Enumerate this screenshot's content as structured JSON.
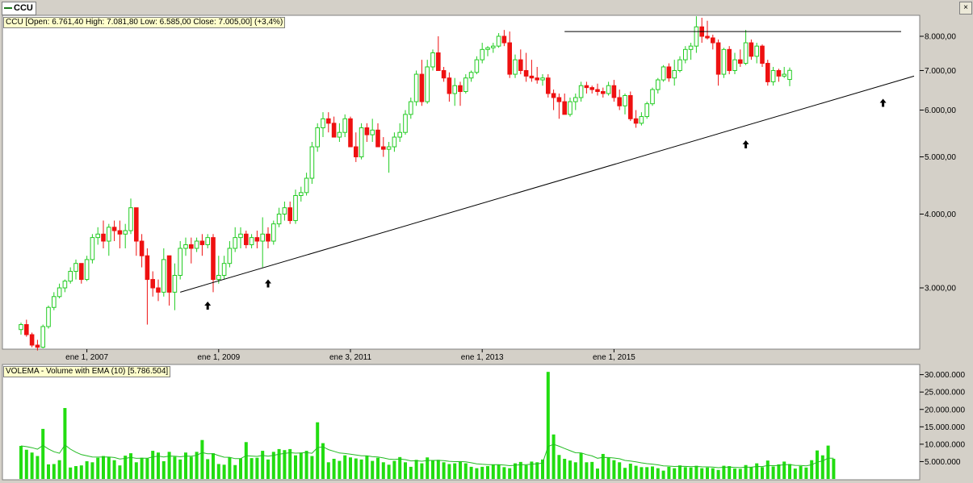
{
  "window": {
    "symbol_tab": "CCU",
    "close_glyph": "×"
  },
  "price_panel": {
    "info": "CCU [Open: 6.761,40  High: 7.081,80  Low: 6.585,00  Close: 7.005,00] (+3,4%)",
    "y_ticks": [
      "8.000,00",
      "7.000,00",
      "6.000,00",
      "5.000,00",
      "4.000,00",
      "3.000,00"
    ],
    "x_ticks": [
      "ene 1, 2007",
      "ene 1, 2009",
      "ene 3, 2011",
      "ene 1, 2013",
      "ene 1, 2015"
    ]
  },
  "volume_panel": {
    "info": "VOLEMA - Volume with EMA (10) [5.786.504]",
    "y_ticks": [
      "30.000.000",
      "25.000.000",
      "20.000.000",
      "15.000.000",
      "10.000.000",
      "5.000.000"
    ]
  },
  "colors": {
    "up": "#22cc22",
    "down": "#ee1111",
    "volume": "#22dd11",
    "ema": "#22bb22",
    "line": "#000000"
  },
  "chart_data": {
    "type": "candlestick",
    "frequency": "monthly",
    "price_scale": "log",
    "price_ylim": [
      2400,
      8600
    ],
    "volume_ylim": [
      0,
      32000000
    ],
    "annotations": [
      {
        "type": "resistance_line",
        "level": 8150
      },
      {
        "type": "support_trendline",
        "from": 2950,
        "to": 6850
      },
      {
        "type": "up_arrows",
        "count": 4
      }
    ],
    "candles": [
      [
        2550,
        2620,
        2500,
        2600
      ],
      [
        2600,
        2650,
        2480,
        2500
      ],
      [
        2500,
        2520,
        2380,
        2400
      ],
      [
        2400,
        2450,
        2350,
        2380
      ],
      [
        2380,
        2600,
        2370,
        2580
      ],
      [
        2580,
        2800,
        2560,
        2780
      ],
      [
        2780,
        2950,
        2750,
        2900
      ],
      [
        2900,
        3050,
        2880,
        3000
      ],
      [
        3000,
        3100,
        2950,
        3080
      ],
      [
        3080,
        3250,
        3050,
        3200
      ],
      [
        3200,
        3350,
        3100,
        3300
      ],
      [
        3300,
        3300,
        3050,
        3100
      ],
      [
        3100,
        3400,
        3080,
        3350
      ],
      [
        3350,
        3700,
        3300,
        3650
      ],
      [
        3650,
        3800,
        3550,
        3700
      ],
      [
        3700,
        3900,
        3500,
        3600
      ],
      [
        3600,
        3850,
        3400,
        3800
      ],
      [
        3800,
        3900,
        3600,
        3750
      ],
      [
        3750,
        3900,
        3500,
        3700
      ],
      [
        3700,
        3850,
        3500,
        3750
      ],
      [
        3750,
        4250,
        3700,
        4100
      ],
      [
        4100,
        4100,
        3400,
        3600
      ],
      [
        3600,
        3700,
        3250,
        3400
      ],
      [
        3400,
        3500,
        2600,
        3100
      ],
      [
        3100,
        3200,
        2900,
        3000
      ],
      [
        3000,
        3100,
        2850,
        2950
      ],
      [
        2950,
        3500,
        2900,
        3350
      ],
      [
        3400,
        3400,
        2800,
        2950
      ],
      [
        2950,
        3300,
        2750,
        3150
      ],
      [
        3150,
        3600,
        3100,
        3500
      ],
      [
        3500,
        3650,
        3400,
        3550
      ],
      [
        3550,
        3650,
        3300,
        3500
      ],
      [
        3500,
        3650,
        3450,
        3600
      ],
      [
        3600,
        3700,
        3400,
        3550
      ],
      [
        3550,
        3700,
        3500,
        3650
      ],
      [
        3650,
        3700,
        2950,
        3100
      ],
      [
        3100,
        3400,
        3050,
        3150
      ],
      [
        3150,
        3400,
        3100,
        3300
      ],
      [
        3300,
        3600,
        3250,
        3500
      ],
      [
        3500,
        3800,
        3450,
        3650
      ],
      [
        3650,
        3800,
        3500,
        3700
      ],
      [
        3700,
        3750,
        3500,
        3550
      ],
      [
        3550,
        3700,
        3500,
        3650
      ],
      [
        3650,
        3750,
        3500,
        3600
      ],
      [
        3600,
        3950,
        3250,
        3700
      ],
      [
        3700,
        3800,
        3500,
        3600
      ],
      [
        3600,
        3900,
        3550,
        3850
      ],
      [
        3850,
        4100,
        3800,
        4000
      ],
      [
        4000,
        4200,
        3900,
        4100
      ],
      [
        4100,
        4200,
        3850,
        3900
      ],
      [
        3900,
        4400,
        3850,
        4300
      ],
      [
        4300,
        4450,
        4200,
        4350
      ],
      [
        4350,
        4700,
        4300,
        4600
      ],
      [
        4600,
        5300,
        4500,
        5200
      ],
      [
        5200,
        5700,
        5100,
        5600
      ],
      [
        5600,
        5950,
        5400,
        5800
      ],
      [
        5800,
        5950,
        5500,
        5700
      ],
      [
        5700,
        5850,
        5400,
        5400
      ],
      [
        5400,
        5700,
        5300,
        5500
      ],
      [
        5500,
        5900,
        5400,
        5800
      ],
      [
        5800,
        5850,
        5200,
        5200
      ],
      [
        5200,
        5500,
        4900,
        5000
      ],
      [
        5000,
        5700,
        4950,
        5600
      ],
      [
        5600,
        5700,
        5300,
        5450
      ],
      [
        5450,
        5800,
        5300,
        5550
      ],
      [
        5550,
        5700,
        5200,
        5200
      ],
      [
        5200,
        5400,
        5000,
        5150
      ],
      [
        5150,
        5300,
        4700,
        5200
      ],
      [
        5200,
        5500,
        5100,
        5400
      ],
      [
        5400,
        5700,
        5300,
        5500
      ],
      [
        5500,
        6000,
        5450,
        5900
      ],
      [
        5900,
        6300,
        5800,
        6200
      ],
      [
        6200,
        7000,
        6100,
        6900
      ],
      [
        6900,
        7300,
        6100,
        6200
      ],
      [
        6200,
        7300,
        6150,
        7100
      ],
      [
        7100,
        7600,
        7000,
        7500
      ],
      [
        7500,
        8000,
        7000,
        7000
      ],
      [
        7000,
        7100,
        6700,
        6800
      ],
      [
        6800,
        6950,
        6200,
        6400
      ],
      [
        6400,
        6800,
        6100,
        6600
      ],
      [
        6600,
        6700,
        6100,
        6450
      ],
      [
        6450,
        6900,
        6400,
        6800
      ],
      [
        6800,
        7000,
        6700,
        6950
      ],
      [
        6950,
        7400,
        6900,
        7300
      ],
      [
        7300,
        7800,
        7200,
        7600
      ],
      [
        7600,
        7700,
        7400,
        7650
      ],
      [
        7650,
        7800,
        7500,
        7700
      ],
      [
        7700,
        8100,
        7650,
        8000
      ],
      [
        8000,
        8200,
        7700,
        7800
      ],
      [
        7800,
        8150,
        6800,
        6900
      ],
      [
        6900,
        7450,
        6800,
        7300
      ],
      [
        7300,
        7600,
        6900,
        7000
      ],
      [
        7000,
        7500,
        6700,
        6850
      ],
      [
        6850,
        7300,
        6700,
        6800
      ],
      [
        6800,
        7100,
        6650,
        6750
      ],
      [
        6750,
        6900,
        6600,
        6800
      ],
      [
        6800,
        6900,
        6300,
        6400
      ],
      [
        6400,
        6500,
        6000,
        6300
      ],
      [
        6300,
        6400,
        5800,
        6200
      ],
      [
        6200,
        6400,
        5900,
        5900
      ],
      [
        5900,
        6300,
        5850,
        6200
      ],
      [
        6200,
        6400,
        6000,
        6300
      ],
      [
        6300,
        6700,
        6200,
        6600
      ],
      [
        6600,
        6700,
        6400,
        6550
      ],
      [
        6550,
        6600,
        6400,
        6500
      ],
      [
        6500,
        6650,
        6350,
        6450
      ],
      [
        6450,
        6550,
        6300,
        6400
      ],
      [
        6400,
        6700,
        6350,
        6600
      ],
      [
        6600,
        6750,
        6200,
        6300
      ],
      [
        6300,
        6500,
        6000,
        6100
      ],
      [
        6100,
        6400,
        5900,
        6350
      ],
      [
        6350,
        6450,
        5750,
        5800
      ],
      [
        5800,
        6000,
        5600,
        5700
      ],
      [
        5700,
        5950,
        5650,
        5850
      ],
      [
        5850,
        6200,
        5800,
        6150
      ],
      [
        6150,
        6550,
        6100,
        6500
      ],
      [
        6500,
        6800,
        6400,
        6750
      ],
      [
        6750,
        7150,
        6700,
        7100
      ],
      [
        7100,
        7200,
        6700,
        6800
      ],
      [
        6800,
        7300,
        6600,
        7000
      ],
      [
        7000,
        7400,
        6950,
        7300
      ],
      [
        7300,
        7700,
        7200,
        7600
      ],
      [
        7600,
        7800,
        7300,
        7700
      ],
      [
        7700,
        8650,
        7500,
        8300
      ],
      [
        8300,
        8600,
        7800,
        8000
      ],
      [
        8000,
        8500,
        7900,
        7950
      ],
      [
        7950,
        8050,
        7600,
        7800
      ],
      [
        7800,
        7900,
        6600,
        6900
      ],
      [
        6900,
        7650,
        6800,
        7600
      ],
      [
        7600,
        7700,
        6900,
        7000
      ],
      [
        7000,
        7500,
        6900,
        7300
      ],
      [
        7300,
        7600,
        7100,
        7200
      ],
      [
        7200,
        8200,
        7150,
        7800
      ],
      [
        7800,
        7900,
        7300,
        7400
      ],
      [
        7400,
        7800,
        7200,
        7700
      ],
      [
        7700,
        7750,
        7100,
        7200
      ],
      [
        7200,
        7300,
        6600,
        6700
      ],
      [
        6700,
        7100,
        6600,
        7000
      ],
      [
        7000,
        7050,
        6700,
        6850
      ],
      [
        6850,
        7100,
        6800,
        6900
      ],
      [
        6761,
        7082,
        6585,
        7005
      ]
    ],
    "volume": [
      9.5,
      8.4,
      7.6,
      6.6,
      14.4,
      4.2,
      4.3,
      5.4,
      20.4,
      3.3,
      3.7,
      3.9,
      5.1,
      4.8,
      6.1,
      6.6,
      6.3,
      5.4,
      3.9,
      6.7,
      7.4,
      4.8,
      6.1,
      5.9,
      8.1,
      7.6,
      5.1,
      7.8,
      6.4,
      5.6,
      7.6,
      6.4,
      7.8,
      11.2,
      5.7,
      7.4,
      4.3,
      4.1,
      6.2,
      4.0,
      5.9,
      10.6,
      6.0,
      6.1,
      8.1,
      5.6,
      7.8,
      8.6,
      8.3,
      8.6,
      6.8,
      7.6,
      8.1,
      6.6,
      16.3,
      10.3,
      4.8,
      5.8,
      5.2,
      6.8,
      6.2,
      5.9,
      5.6,
      6.6,
      5.2,
      6.1,
      4.8,
      4.1,
      5.2,
      6.3,
      4.8,
      3.5,
      5.5,
      4.5,
      6.2,
      5.4,
      5.5,
      4.8,
      4.3,
      4.5,
      5.1,
      4.5,
      3.5,
      3.1,
      3.5,
      3.7,
      4.1,
      4.1,
      3.4,
      3.1,
      4.5,
      4.9,
      4.0,
      5.0,
      4.8,
      5.6,
      30.8,
      12.8,
      6.9,
      5.8,
      5.3,
      4.8,
      7.4,
      4.8,
      4.9,
      3.0,
      7.2,
      6.1,
      5.4,
      4.8,
      3.2,
      4.4,
      3.8,
      3.4,
      3.4,
      3.6,
      3.1,
      2.4,
      3.5,
      3.1,
      3.9,
      3.4,
      3.3,
      3.8,
      3.1,
      3.3,
      3.1,
      2.6,
      3.8,
      3.7,
      3.0,
      2.9,
      4.0,
      3.4,
      4.5,
      3.4,
      5.3,
      3.6,
      4.2,
      5.0,
      4.3,
      3.0,
      3.7,
      3.3,
      5.4,
      8.2,
      6.8,
      9.6,
      5.8
    ],
    "ema_values": "computed"
  }
}
